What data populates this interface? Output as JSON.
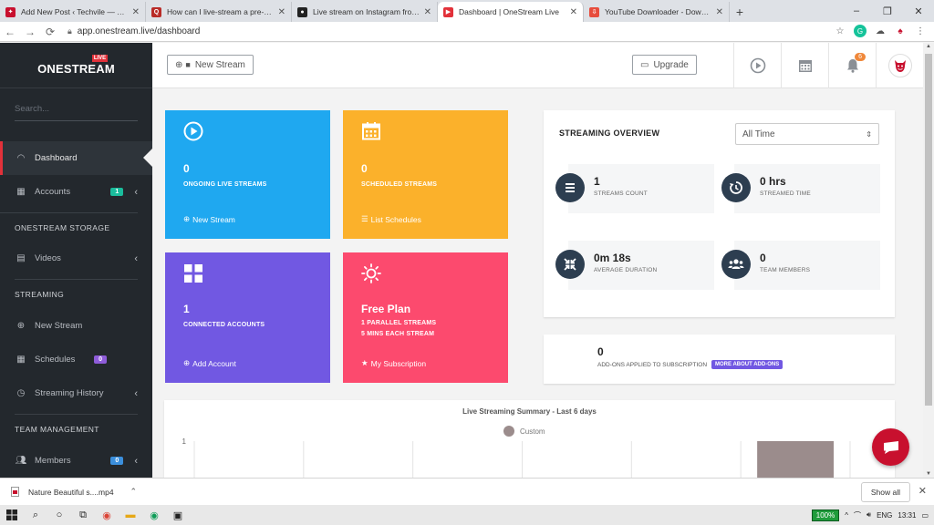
{
  "browser": {
    "tabs": [
      {
        "title": "Add New Post ‹ Techvile — Tech",
        "fav_color": "#c8102e",
        "fav_glyph": "✦"
      },
      {
        "title": "How can I live-stream a pre-reco",
        "fav_color": "#b92b27",
        "fav_glyph": "Q"
      },
      {
        "title": "Live stream on Instagram from yo",
        "fav_color": "#222222",
        "fav_glyph": "●"
      },
      {
        "title": "Dashboard | OneStream Live",
        "fav_color": "#e2313a",
        "fav_glyph": "▶"
      },
      {
        "title": "YouTube Downloader - Downloa",
        "fav_color": "#e74c3c",
        "fav_glyph": "⇩"
      }
    ],
    "url": "app.onestream.live/dashboard"
  },
  "sidebar": {
    "logo_live": "LIVE",
    "logo_name": "ONESTREAM",
    "search_placeholder": "Search...",
    "dashboard": "Dashboard",
    "accounts": "Accounts",
    "accounts_badge": "1",
    "storage_header": "ONESTREAM STORAGE",
    "videos": "Videos",
    "streaming_header": "STREAMING",
    "new_stream": "New Stream",
    "schedules": "Schedules",
    "schedules_badge": "0",
    "streaming_history": "Streaming History",
    "team_header": "TEAM MANAGEMENT",
    "members": "Members",
    "members_badge": "0"
  },
  "header": {
    "new_stream": "New Stream",
    "upgrade": "Upgrade",
    "notification_count": "6"
  },
  "cards": {
    "ongoing": {
      "value": "0",
      "label": "ONGOING LIVE STREAMS",
      "link": "New Stream",
      "color": "#1fa8f0"
    },
    "scheduled": {
      "value": "0",
      "label": "SCHEDULED STREAMS",
      "link": "List Schedules",
      "color": "#fbb12b"
    },
    "connected": {
      "value": "1",
      "label": "CONNECTED ACCOUNTS",
      "link": "Add Account",
      "color": "#7158e2"
    },
    "plan": {
      "value": "Free Plan",
      "label1": "1 PARALLEL STREAMS",
      "label2": "5 MINS EACH STREAM",
      "link": "My Subscription",
      "color": "#fc4a6e"
    }
  },
  "overview": {
    "title": "STREAMING OVERVIEW",
    "filter": "All Time",
    "streams_count": {
      "value": "1",
      "label": "STREAMS COUNT"
    },
    "streamed_time": {
      "value": "0 hrs",
      "label": "STREAMED TIME"
    },
    "avg_duration": {
      "value": "0m 18s",
      "label": "AVERAGE DURATION"
    },
    "team_members": {
      "value": "0",
      "label": "TEAM MEMBERS"
    }
  },
  "addons": {
    "value": "0",
    "label": "ADD-ONS APPLIED TO SUBSCRIPTION",
    "more": "MORE ABOUT ADD-ONS"
  },
  "chart_data": {
    "type": "bar",
    "title": "Live Streaming Summary - Last 6 days",
    "series": [
      {
        "name": "Custom",
        "values": [
          0,
          0,
          0,
          0,
          0,
          1
        ],
        "color": "#9b8c8c"
      }
    ],
    "categories": [
      "",
      "",
      "",
      "",
      "",
      ""
    ],
    "ylim": [
      0,
      1
    ],
    "y_ticks": [
      "1"
    ],
    "grid": true
  },
  "downloads": {
    "file": "Nature Beautiful s....mp4",
    "show_all": "Show all"
  },
  "taskbar": {
    "zoom": "100%",
    "lang": "ENG",
    "time": "13:31"
  }
}
